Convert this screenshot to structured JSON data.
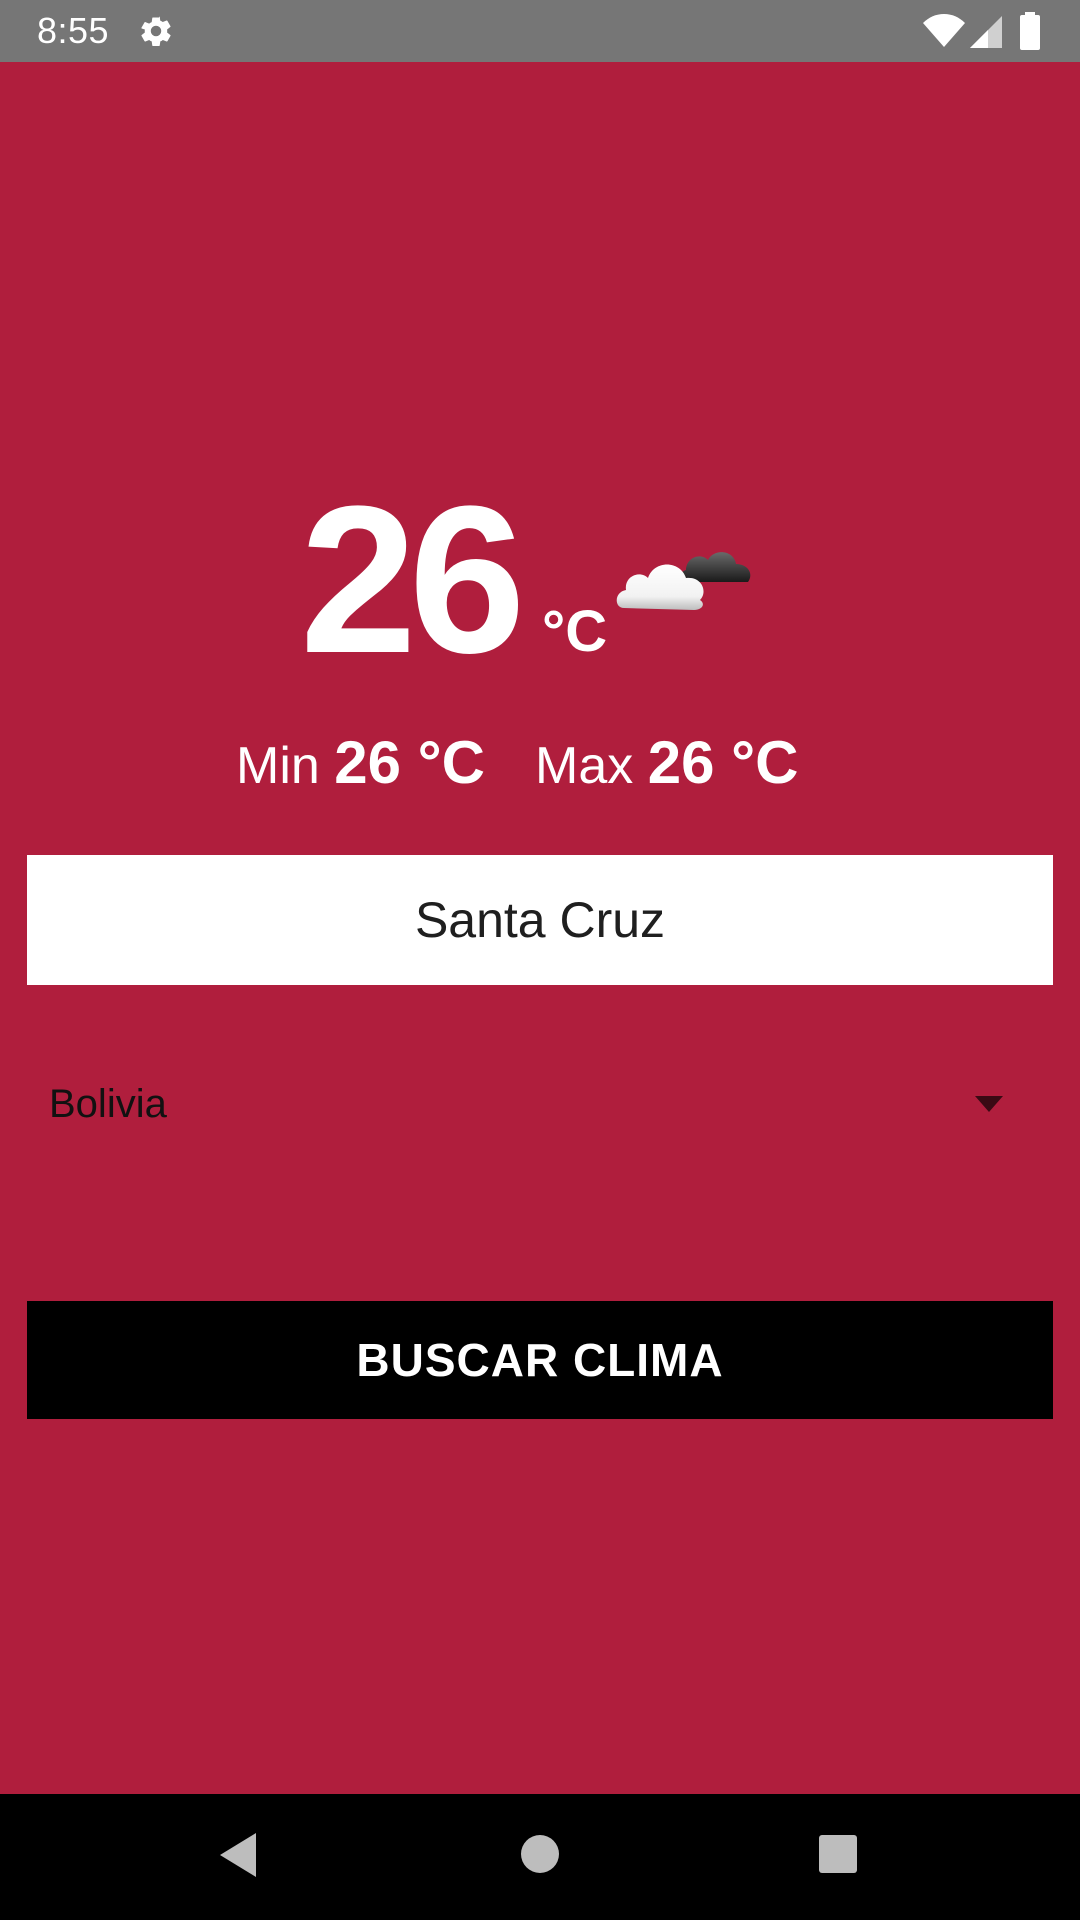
{
  "status_bar": {
    "time": "8:55",
    "icons": [
      "gear-icon",
      "wifi-icon",
      "signal-icon",
      "battery-icon"
    ]
  },
  "weather": {
    "temperature": "26",
    "unit": "°C",
    "condition_icon": "cloudy-icon",
    "min_label": "Min",
    "min_value": "26 °C",
    "max_label": "Max",
    "max_value": "26 °C"
  },
  "form": {
    "city_value": "Santa Cruz",
    "country_selected": "Bolivia",
    "search_label": "BUSCAR CLIMA"
  },
  "nav_bar": {
    "icons": [
      "back-icon",
      "home-icon",
      "recents-icon"
    ]
  },
  "colors": {
    "background": "#b01e3d",
    "status_bar": "#767676",
    "button": "#000000",
    "input_bg": "#ffffff"
  }
}
